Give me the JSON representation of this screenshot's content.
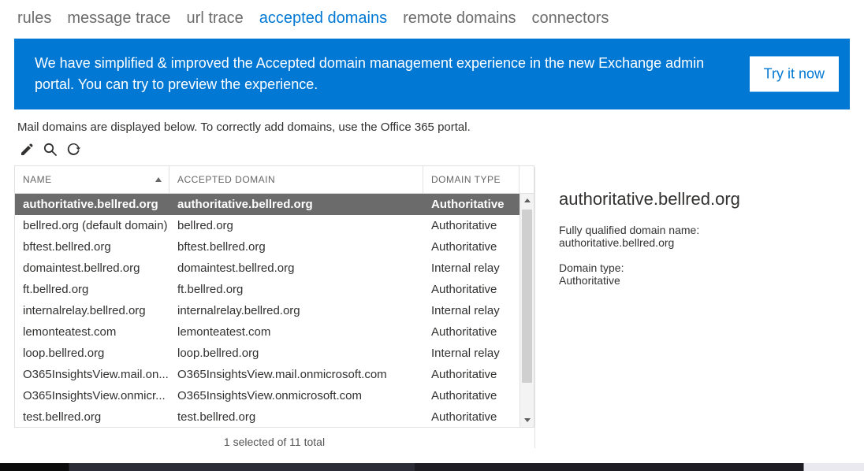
{
  "tabs": [
    {
      "id": "rules",
      "label": "rules"
    },
    {
      "id": "message-trace",
      "label": "message trace"
    },
    {
      "id": "url-trace",
      "label": "url trace"
    },
    {
      "id": "accepted-domains",
      "label": "accepted domains",
      "active": true
    },
    {
      "id": "remote-domains",
      "label": "remote domains"
    },
    {
      "id": "connectors",
      "label": "connectors"
    }
  ],
  "banner": {
    "text": "We have simplified & improved the Accepted domain management experience in the new Exchange admin portal. You can try to preview the experience.",
    "button": "Try it now"
  },
  "description": "Mail domains are displayed below. To correctly add domains, use the Office 365 portal.",
  "columns": {
    "name": "NAME",
    "accepted": "ACCEPTED DOMAIN",
    "type": "DOMAIN TYPE"
  },
  "rows": [
    {
      "name": "authoritative.bellred.org",
      "accepted": "authoritative.bellred.org",
      "type": "Authoritative",
      "selected": true
    },
    {
      "name": "bellred.org (default domain)",
      "accepted": "bellred.org",
      "type": "Authoritative"
    },
    {
      "name": "bftest.bellred.org",
      "accepted": "bftest.bellred.org",
      "type": "Authoritative"
    },
    {
      "name": "domaintest.bellred.org",
      "accepted": "domaintest.bellred.org",
      "type": "Internal relay"
    },
    {
      "name": "ft.bellred.org",
      "accepted": "ft.bellred.org",
      "type": "Authoritative"
    },
    {
      "name": "internalrelay.bellred.org",
      "accepted": "internalrelay.bellred.org",
      "type": "Internal relay"
    },
    {
      "name": "lemonteatest.com",
      "accepted": "lemonteatest.com",
      "type": "Authoritative"
    },
    {
      "name": "loop.bellred.org",
      "accepted": "loop.bellred.org",
      "type": "Internal relay"
    },
    {
      "name": "O365InsightsView.mail.on...",
      "accepted": "O365InsightsView.mail.onmicrosoft.com",
      "type": "Authoritative"
    },
    {
      "name": "O365InsightsView.onmicr...",
      "accepted": "O365InsightsView.onmicrosoft.com",
      "type": "Authoritative"
    },
    {
      "name": "test.bellred.org",
      "accepted": "test.bellred.org",
      "type": "Authoritative"
    }
  ],
  "status": "1 selected of 11 total",
  "details": {
    "title": "authoritative.bellred.org",
    "fqdn_label": "Fully qualified domain name:",
    "fqdn_value": "authoritative.bellred.org",
    "type_label": "Domain type:",
    "type_value": "Authoritative"
  }
}
